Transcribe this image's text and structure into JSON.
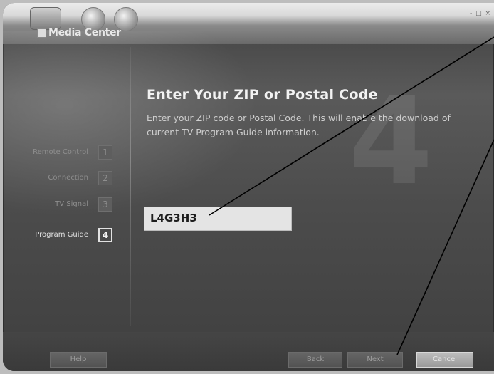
{
  "app": {
    "title": "Media Center"
  },
  "window_controls": "- □ ×",
  "page": {
    "title": "Enter Your ZIP or Postal Code",
    "description": "Enter your ZIP code or Postal Code. This will enable the download of current TV Program Guide information.",
    "step_number": "4"
  },
  "zip_input": {
    "value": "L4G3H3"
  },
  "steps": [
    {
      "label": "Remote Control",
      "number": "1"
    },
    {
      "label": "Connection",
      "number": "2"
    },
    {
      "label": "TV Signal",
      "number": "3"
    },
    {
      "label": "Program Guide",
      "number": "4",
      "active": true
    }
  ],
  "footer": {
    "help": "Help",
    "back": "Back",
    "next": "Next",
    "cancel": "Cancel"
  }
}
